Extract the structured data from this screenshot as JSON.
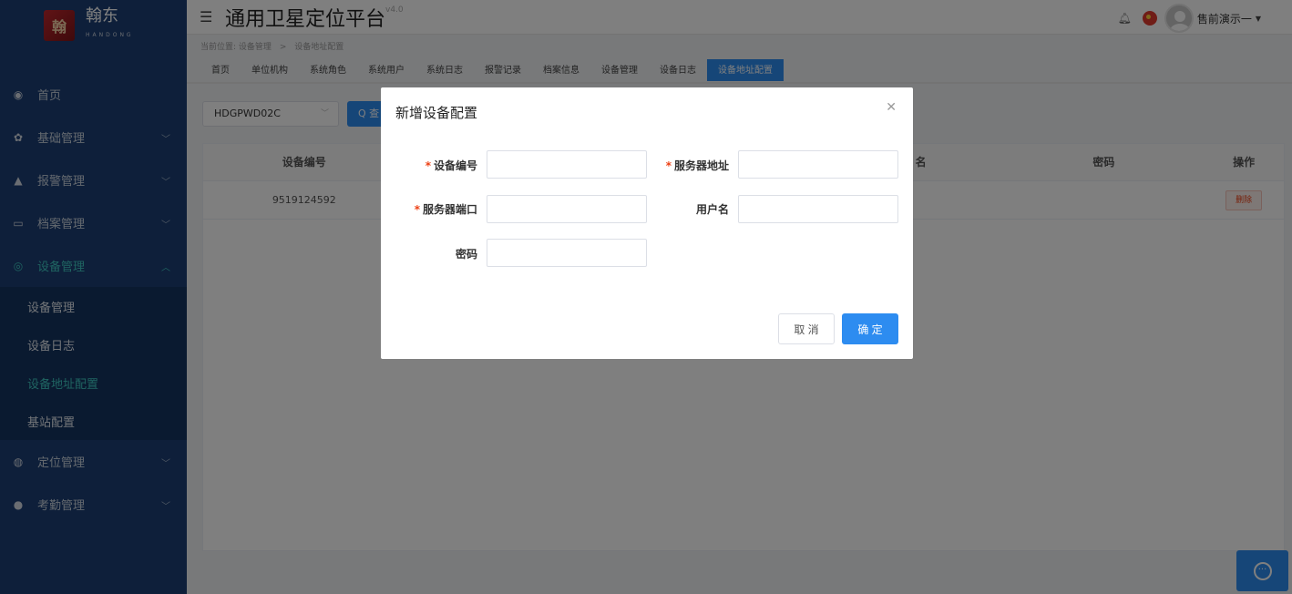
{
  "sidebar": {
    "logo_mark": "翰东",
    "logo_text": "翰东",
    "logo_sub": "HANDONG",
    "items": [
      {
        "label": "首页",
        "icon": "dashboard-icon"
      },
      {
        "label": "基础管理",
        "icon": "gear-icon"
      },
      {
        "label": "报警管理",
        "icon": "bell-icon"
      },
      {
        "label": "档案管理",
        "icon": "folder-icon"
      },
      {
        "label": "设备管理",
        "icon": "device-icon"
      },
      {
        "label": "定位管理",
        "icon": "location-icon"
      },
      {
        "label": "考勤管理",
        "icon": "bulb-icon"
      }
    ],
    "submenu": [
      "设备管理",
      "设备日志",
      "设备地址配置",
      "基站配置"
    ]
  },
  "header": {
    "title": "通用卫星定位平台",
    "version": "v4.0",
    "username": "售前演示一"
  },
  "breadcrumb": {
    "prefix": "当前位置:",
    "level1": "设备管理",
    "level2": "设备地址配置"
  },
  "tabs": [
    "首页",
    "单位机构",
    "系统角色",
    "系统用户",
    "系统日志",
    "报警记录",
    "档案信息",
    "设备管理",
    "设备日志",
    "设备地址配置"
  ],
  "toolbar": {
    "device_select": "HDGPWD02C",
    "query_label": "查"
  },
  "table": {
    "headers": {
      "c1": "设备编号",
      "c3": "密码",
      "c4": "操作"
    },
    "partial_header": "名",
    "rows": [
      {
        "device_no": "9519124592",
        "delete_label": "删除"
      }
    ]
  },
  "modal": {
    "title": "新增设备配置",
    "fields": {
      "device_no": {
        "label": "设备编号",
        "value": "",
        "required": true
      },
      "server_addr": {
        "label": "服务器地址",
        "value": "",
        "required": true
      },
      "server_port": {
        "label": "服务器端口",
        "value": "",
        "required": true
      },
      "username": {
        "label": "用户名",
        "value": "",
        "required": false
      },
      "password": {
        "label": "密码",
        "value": "",
        "required": false
      }
    },
    "cancel_label": "取 消",
    "ok_label": "确 定"
  },
  "colors": {
    "sidebar_bg": "#1c3f74",
    "accent": "#2d8cf0",
    "active_menu": "#3ec9c3",
    "required": "#ed4014"
  }
}
